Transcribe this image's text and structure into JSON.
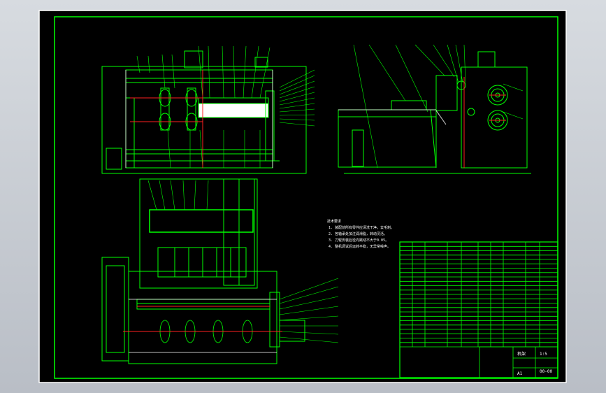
{
  "drawing": {
    "background": "#000000",
    "line_color": "#00ff00",
    "accent_red": "#ff2020",
    "accent_white": "#ffffff",
    "accent_yellow": "#ffff66",
    "frame": "outer border + inner green title frame",
    "views": [
      "front-view",
      "side-view",
      "top-view"
    ],
    "notes_heading": "技术要求",
    "notes_lines": [
      "1. 装配前所有零件应清洗干净，去毛刺。",
      "2. 各轴承处加注润滑脂，转动灵活。",
      "3. 刀辊安装后径向跳动不大于0.05。",
      "4. 整机调试后运转平稳，无异常噪声。"
    ],
    "title_block": {
      "name": "机架",
      "drawing_no": "00-00",
      "scale": "1:5",
      "sheet": "A1"
    },
    "parts_list_rows": 24
  }
}
